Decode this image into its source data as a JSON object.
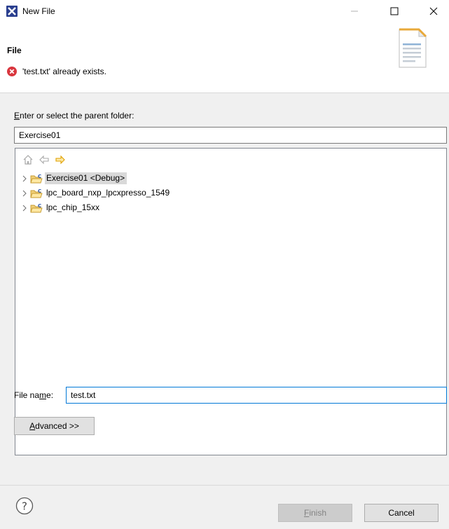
{
  "window": {
    "title": "New File",
    "controls": {
      "minimize": "—",
      "maximize": "☐",
      "close": "✕"
    }
  },
  "banner": {
    "title": "File",
    "error_message": "'test.txt' already exists.",
    "error_icon": "error-icon",
    "illustration_icon": "document-icon"
  },
  "parent": {
    "label": "Enter or select the parent folder:",
    "label_mnemonic": "E",
    "value": "Exercise01"
  },
  "tree": {
    "toolbar": [
      "home-icon",
      "back-arrow-icon",
      "forward-arrow-icon"
    ],
    "items": [
      {
        "label": "Exercise01 <Debug>",
        "selected": true
      },
      {
        "label": "lpc_board_nxp_lpcxpresso_1549",
        "selected": false
      },
      {
        "label": "lpc_chip_15xx",
        "selected": false
      }
    ]
  },
  "filename": {
    "label_prefix": "File na",
    "label_mnemonic": "m",
    "label_suffix": "e:",
    "value": "test.txt"
  },
  "buttons": {
    "advanced": "Advanced >>",
    "finish": "Finish",
    "cancel": "Cancel"
  },
  "colors": {
    "accent": "#0078d7",
    "error": "#d9363e",
    "selection": "#d9d9d9",
    "dialog_bg": "#f0f0f0"
  }
}
